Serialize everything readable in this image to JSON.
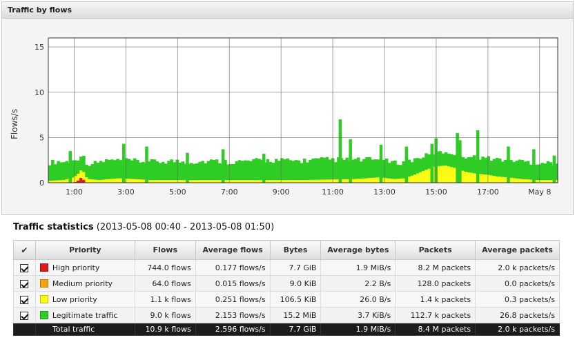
{
  "panel": {
    "title": "Traffic by flows"
  },
  "colors": {
    "high": "#e01818",
    "medium": "#f5a30c",
    "low": "#fbfb14",
    "legitimate": "#2ecc24"
  },
  "chart_data": {
    "type": "area",
    "ylabel": "Flows/s",
    "ylim": [
      0,
      16
    ],
    "yticks": [
      0,
      5,
      10,
      15
    ],
    "xtick_labels": [
      "1:00",
      "3:00",
      "5:00",
      "7:00",
      "9:00",
      "11:00",
      "13:00",
      "15:00",
      "17:00",
      "May 8"
    ],
    "grid": true,
    "stacked": true,
    "series": [
      {
        "name": "High priority",
        "color_key": "high",
        "points": [
          [
            0.0,
            0
          ],
          [
            0.05,
            0
          ],
          [
            0.06,
            0.3
          ],
          [
            0.065,
            0.6
          ],
          [
            0.07,
            0.3
          ],
          [
            0.075,
            0
          ],
          [
            1.0,
            0
          ]
        ]
      },
      {
        "name": "Medium priority",
        "color_key": "medium",
        "points": [
          [
            0.0,
            0
          ],
          [
            1.0,
            0
          ]
        ]
      },
      {
        "name": "Low priority",
        "color_key": "low",
        "points": [
          [
            0.0,
            0.2
          ],
          [
            0.03,
            0.3
          ],
          [
            0.05,
            0.6
          ],
          [
            0.068,
            0.9
          ],
          [
            0.08,
            0.4
          ],
          [
            0.1,
            0.3
          ],
          [
            0.14,
            0.5
          ],
          [
            0.2,
            0.3
          ],
          [
            0.3,
            0.3
          ],
          [
            0.4,
            0.3
          ],
          [
            0.5,
            0.3
          ],
          [
            0.6,
            0.4
          ],
          [
            0.65,
            0.6
          ],
          [
            0.68,
            0.4
          ],
          [
            0.7,
            0.5
          ],
          [
            0.72,
            0.9
          ],
          [
            0.74,
            1.4
          ],
          [
            0.76,
            1.8
          ],
          [
            0.78,
            1.9
          ],
          [
            0.8,
            1.6
          ],
          [
            0.82,
            1.2
          ],
          [
            0.84,
            1.0
          ],
          [
            0.86,
            0.9
          ],
          [
            0.88,
            0.7
          ],
          [
            0.9,
            0.6
          ],
          [
            0.93,
            0.4
          ],
          [
            0.96,
            0.3
          ],
          [
            1.0,
            0.3
          ]
        ]
      },
      {
        "name": "Legitimate traffic",
        "color_key": "legitimate",
        "points": [
          [
            0.0,
            2.0
          ],
          [
            0.02,
            2.1
          ],
          [
            0.04,
            1.9
          ],
          [
            0.06,
            1.7
          ],
          [
            0.08,
            1.6
          ],
          [
            0.1,
            2.0
          ],
          [
            0.12,
            2.1
          ],
          [
            0.14,
            1.9
          ],
          [
            0.16,
            2.0
          ],
          [
            0.2,
            2.0
          ],
          [
            0.24,
            2.1
          ],
          [
            0.28,
            2.0
          ],
          [
            0.32,
            2.1
          ],
          [
            0.36,
            2.0
          ],
          [
            0.4,
            2.1
          ],
          [
            0.44,
            2.2
          ],
          [
            0.48,
            2.1
          ],
          [
            0.52,
            2.2
          ],
          [
            0.56,
            2.2
          ],
          [
            0.6,
            2.1
          ],
          [
            0.64,
            2.0
          ],
          [
            0.68,
            1.8
          ],
          [
            0.72,
            1.7
          ],
          [
            0.74,
            1.6
          ],
          [
            0.76,
            1.5
          ],
          [
            0.78,
            1.5
          ],
          [
            0.8,
            1.6
          ],
          [
            0.82,
            1.7
          ],
          [
            0.84,
            1.8
          ],
          [
            0.88,
            1.9
          ],
          [
            0.92,
            2.0
          ],
          [
            0.96,
            1.9
          ],
          [
            1.0,
            1.9
          ]
        ]
      }
    ],
    "spikes": [
      [
        0.04,
        3.5
      ],
      [
        0.145,
        4.3
      ],
      [
        0.19,
        4.0
      ],
      [
        0.27,
        3.3
      ],
      [
        0.34,
        3.7
      ],
      [
        0.42,
        3.2
      ],
      [
        0.57,
        7.0
      ],
      [
        0.59,
        4.8
      ],
      [
        0.65,
        4.2
      ],
      [
        0.7,
        4.0
      ],
      [
        0.75,
        4.3
      ],
      [
        0.758,
        4.9
      ],
      [
        0.8,
        5.5
      ],
      [
        0.805,
        4.7
      ],
      [
        0.84,
        5.8
      ],
      [
        0.9,
        4.0
      ],
      [
        0.95,
        3.7
      ],
      [
        0.99,
        3.0
      ]
    ]
  },
  "stats": {
    "title": "Traffic statistics",
    "range": "(2013-05-08 00:40 - 2013-05-08 01:50)",
    "headers": {
      "check": "✔",
      "priority": "Priority",
      "flows": "Flows",
      "avg_flows": "Average flows",
      "bytes": "Bytes",
      "avg_bytes": "Average bytes",
      "packets": "Packets",
      "avg_packets": "Average packets"
    },
    "rows": [
      {
        "priority": "High priority",
        "color_key": "high",
        "flows": "744.0 flows",
        "avg_flows": "0.177 flows/s",
        "bytes": "7.7 GiB",
        "avg_bytes": "1.9 MiB/s",
        "packets": "8.2 M packets",
        "avg_packets": "2.0 k packets/s"
      },
      {
        "priority": "Medium priority",
        "color_key": "medium",
        "flows": "64.0 flows",
        "avg_flows": "0.015 flows/s",
        "bytes": "9.0 KiB",
        "avg_bytes": "2.2 B/s",
        "packets": "128.0 packets",
        "avg_packets": "0.0 packets/s"
      },
      {
        "priority": "Low priority",
        "color_key": "low",
        "flows": "1.1 k flows",
        "avg_flows": "0.251 flows/s",
        "bytes": "106.5 KiB",
        "avg_bytes": "26.0 B/s",
        "packets": "1.4 k packets",
        "avg_packets": "0.3 packets/s"
      },
      {
        "priority": "Legitimate traffic",
        "color_key": "legitimate",
        "flows": "9.0 k flows",
        "avg_flows": "2.153 flows/s",
        "bytes": "15.2 MiB",
        "avg_bytes": "3.7 KiB/s",
        "packets": "112.7 k packets",
        "avg_packets": "26.8 packets/s"
      }
    ],
    "total": {
      "priority": "Total traffic",
      "flows": "10.9 k flows",
      "avg_flows": "2.596 flows/s",
      "bytes": "7.7 GiB",
      "avg_bytes": "1.9 MiB/s",
      "packets": "8.4 M packets",
      "avg_packets": "2.0 k packets/s"
    }
  }
}
